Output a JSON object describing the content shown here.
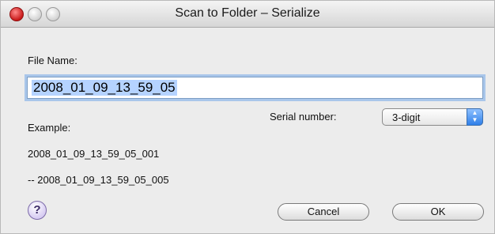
{
  "window": {
    "title": "Scan to Folder – Serialize"
  },
  "file_name": {
    "label": "File Name:",
    "value": "2008_01_09_13_59_05"
  },
  "serial": {
    "label": "Serial number:",
    "selected": "3-digit"
  },
  "example": {
    "label": "Example:",
    "first": "2008_01_09_13_59_05_001",
    "last": "-- 2008_01_09_13_59_05_005"
  },
  "buttons": {
    "help": "?",
    "cancel": "Cancel",
    "ok": "OK"
  },
  "icons": {
    "close": "close-icon",
    "minimize": "minimize-icon",
    "zoom": "zoom-icon",
    "popup_arrows": "updown-arrows-icon",
    "help": "help-icon"
  }
}
